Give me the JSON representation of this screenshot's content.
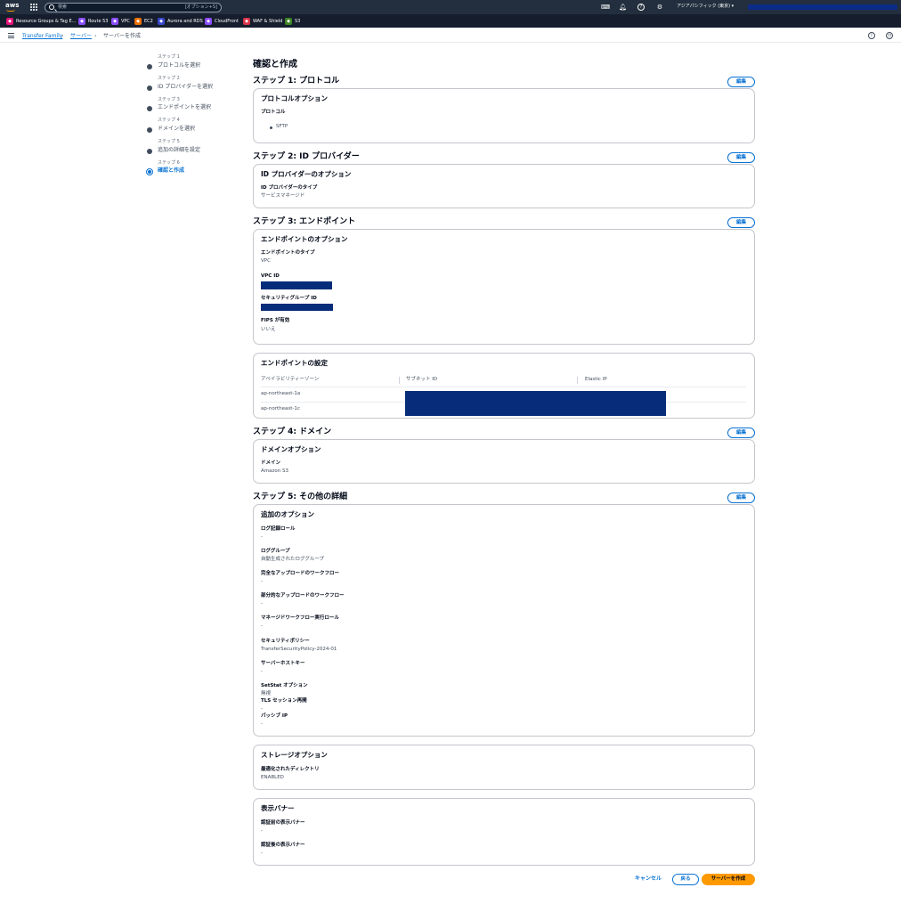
{
  "topbar": {
    "logo": "aws",
    "search_placeholder": "検索",
    "search_shortcut": "[オプション+S]",
    "icons": [
      "cloudshell-icon",
      "bell-icon",
      "help-icon",
      "gear-icon"
    ],
    "region": "アジアパシフィック (東京) ▾"
  },
  "favorites": [
    {
      "label": "Resource Groups & Tag E...",
      "color": "#e7157b",
      "icon": "resource-groups-icon"
    },
    {
      "label": "Route 53",
      "color": "#8c4fff",
      "icon": "route53-icon"
    },
    {
      "label": "VPC",
      "color": "#8c4fff",
      "icon": "vpc-icon"
    },
    {
      "label": "EC2",
      "color": "#ed7100",
      "icon": "ec2-icon"
    },
    {
      "label": "Aurora and RDS",
      "color": "#3b48cc",
      "icon": "rds-icon"
    },
    {
      "label": "CloudFront",
      "color": "#8c4fff",
      "icon": "cloudfront-icon"
    },
    {
      "label": "WAF & Shield",
      "color": "#dd344c",
      "icon": "waf-icon"
    },
    {
      "label": "S3",
      "color": "#3f8624",
      "icon": "s3-icon"
    }
  ],
  "breadcrumb": [
    "Transfer Family",
    "サーバー",
    "サーバーを作成"
  ],
  "steps": [
    {
      "num": "ステップ 1",
      "label": "プロトコルを選択"
    },
    {
      "num": "ステップ 2",
      "label": "ID プロバイダーを選択"
    },
    {
      "num": "ステップ 3",
      "label": "エンドポイントを選択"
    },
    {
      "num": "ステップ 4",
      "label": "ドメインを選択"
    },
    {
      "num": "ステップ 5",
      "label": "追加の詳細を設定"
    },
    {
      "num": "ステップ 6",
      "label": "確認と作成"
    }
  ],
  "page_title": "確認と作成",
  "edit_label": "編集",
  "s1": {
    "heading": "ステップ 1: プロトコル",
    "card_title": "プロトコルオプション",
    "label": "プロトコル",
    "value": "SFTP"
  },
  "s2": {
    "heading": "ステップ 2: ID プロバイダー",
    "card_title": "ID プロバイダーのオプション",
    "label": "ID プロバイダーのタイプ",
    "value": "サービスマネージド"
  },
  "s3": {
    "heading": "ステップ 3: エンドポイント",
    "card_title": "エンドポイントのオプション",
    "type_label": "エンドポイントのタイプ",
    "type_value": "VPC",
    "vpc_label": "VPC ID",
    "sg_label": "セキュリティグループ ID",
    "fips_label": "FIPS が有効",
    "fips_value": "いいえ",
    "settings_title": "エンドポイントの設定",
    "columns": [
      "アベイラビリティーゾーン",
      "サブネット ID",
      "Elastic IP"
    ],
    "rows": [
      "ap-northeast-1a",
      "ap-northeast-1c"
    ]
  },
  "s4": {
    "heading": "ステップ 4: ドメイン",
    "card_title": "ドメインオプション",
    "label": "ドメイン",
    "value": "Amazon S3"
  },
  "s5": {
    "heading": "ステップ 5: その他の詳細",
    "card_title": "追加のオプション",
    "fields": [
      {
        "label": "ログ記録ロール",
        "value": "-"
      },
      {
        "label": "ロググループ",
        "value": "自動生成されたロググループ"
      },
      {
        "label": "完全なアップロードのワークフロー",
        "value": "-"
      },
      {
        "label": "部分的なアップロードのワークフロー",
        "value": "-"
      },
      {
        "label": "マネージドワークフロー実行ロール",
        "value": "-"
      },
      {
        "label": "セキュリティポリシー",
        "value": "TransferSecurityPolicy-2024-01"
      },
      {
        "label": "サーバーホストキー",
        "value": "-"
      },
      {
        "label": "SetStat オプション",
        "value": "無視"
      },
      {
        "label": "TLS セッション再開",
        "value": "-"
      },
      {
        "label": "パッシブ IP",
        "value": "-"
      }
    ],
    "storage_title": "ストレージオプション",
    "storage_label": "最適化されたディレクトリ",
    "storage_value": "ENABLED",
    "banner_title": "表示バナー",
    "banner_pre_label": "認証前の表示バナー",
    "banner_pre_value": "-",
    "banner_post_label": "認証後の表示バナー",
    "banner_post_value": "-"
  },
  "actions": {
    "cancel": "キャンセル",
    "back": "戻る",
    "create": "サーバーを作成"
  },
  "colors": {
    "link": "#0972d3",
    "primary": "#ff9900",
    "topbar": "#232f3e",
    "redaction": "#072d7a"
  }
}
